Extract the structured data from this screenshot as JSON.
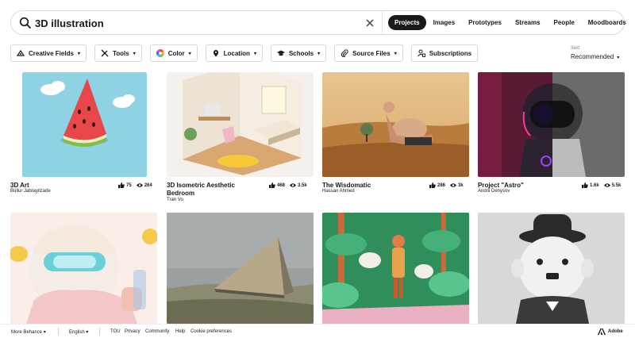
{
  "search": {
    "query": "3D illustration",
    "tabs": [
      "Projects",
      "Images",
      "Prototypes",
      "Streams",
      "People",
      "Moodboards"
    ],
    "active_tab": "Projects"
  },
  "filters": [
    {
      "label": "Creative Fields",
      "icon": "creative-fields-icon"
    },
    {
      "label": "Tools",
      "icon": "tools-icon"
    },
    {
      "label": "Color",
      "icon": "color-wheel-icon"
    },
    {
      "label": "Location",
      "icon": "location-pin-icon"
    },
    {
      "label": "Schools",
      "icon": "graduation-cap-icon"
    },
    {
      "label": "Source Files",
      "icon": "paperclip-icon"
    },
    {
      "label": "Subscriptions",
      "icon": "subscription-icon"
    }
  ],
  "sort": {
    "label": "Sort",
    "value": "Recommended"
  },
  "cards": [
    {
      "title": "3D Art",
      "owner": "Bullur Jabrayilzade",
      "likes": "75",
      "views": "264"
    },
    {
      "title": "3D Isometric Aesthetic Bedroom",
      "owner": "Tran Vo",
      "likes": "468",
      "views": "3.5k"
    },
    {
      "title": "The Wisdomatic",
      "owner": "Hassan Ahmed",
      "likes": "286",
      "views": "3k"
    },
    {
      "title": "Project \"Astro\"",
      "owner": "Andrii Denysov",
      "likes": "1.6k",
      "views": "5.5k"
    }
  ],
  "footer": {
    "more": "More Behance",
    "language": "English",
    "links": [
      "TOU",
      "Privacy",
      "Community",
      "Help",
      "Cookie preferences"
    ],
    "brand": "Adobe"
  },
  "colors": {
    "accent": "#191919",
    "border": "#d9d9d9",
    "adobe_red": "#191919"
  }
}
